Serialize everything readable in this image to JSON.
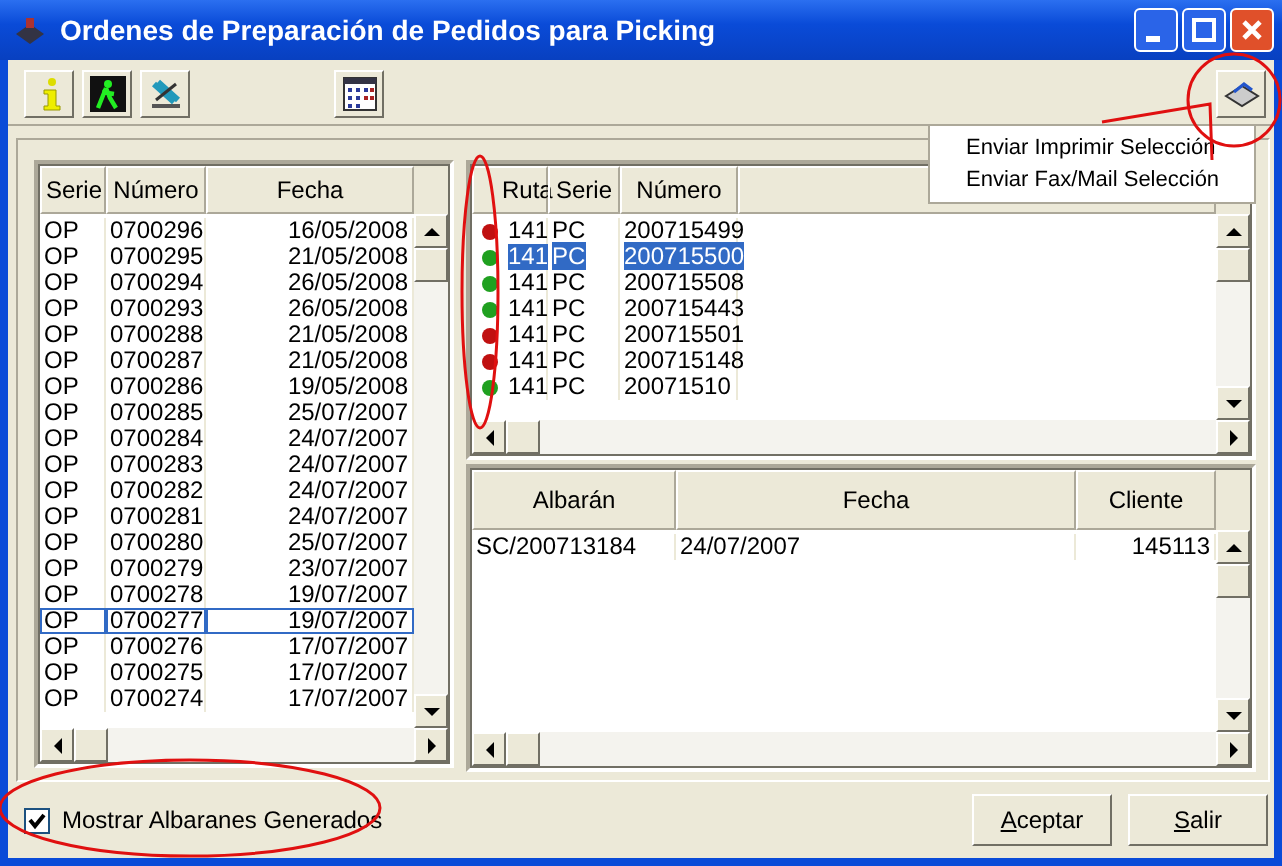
{
  "window": {
    "title": "Ordenes de Preparación de Pedidos para Picking"
  },
  "context_menu": {
    "items": [
      "Enviar Imprimir Selección",
      "Enviar Fax/Mail Selección"
    ]
  },
  "orders_table": {
    "columns": [
      "Serie",
      "Número",
      "Fecha"
    ],
    "rows": [
      {
        "serie": "OP",
        "numero": "0700296",
        "fecha": "16/05/2008",
        "selected": false
      },
      {
        "serie": "OP",
        "numero": "0700295",
        "fecha": "21/05/2008",
        "selected": false
      },
      {
        "serie": "OP",
        "numero": "0700294",
        "fecha": "26/05/2008",
        "selected": false
      },
      {
        "serie": "OP",
        "numero": "0700293",
        "fecha": "26/05/2008",
        "selected": false
      },
      {
        "serie": "OP",
        "numero": "0700288",
        "fecha": "21/05/2008",
        "selected": false
      },
      {
        "serie": "OP",
        "numero": "0700287",
        "fecha": "21/05/2008",
        "selected": false
      },
      {
        "serie": "OP",
        "numero": "0700286",
        "fecha": "19/05/2008",
        "selected": false
      },
      {
        "serie": "OP",
        "numero": "0700285",
        "fecha": "25/07/2007",
        "selected": false
      },
      {
        "serie": "OP",
        "numero": "0700284",
        "fecha": "24/07/2007",
        "selected": false
      },
      {
        "serie": "OP",
        "numero": "0700283",
        "fecha": "24/07/2007",
        "selected": false
      },
      {
        "serie": "OP",
        "numero": "0700282",
        "fecha": "24/07/2007",
        "selected": false
      },
      {
        "serie": "OP",
        "numero": "0700281",
        "fecha": "24/07/2007",
        "selected": false
      },
      {
        "serie": "OP",
        "numero": "0700280",
        "fecha": "25/07/2007",
        "selected": false
      },
      {
        "serie": "OP",
        "numero": "0700279",
        "fecha": "23/07/2007",
        "selected": false
      },
      {
        "serie": "OP",
        "numero": "0700278",
        "fecha": "19/07/2007",
        "selected": false
      },
      {
        "serie": "OP",
        "numero": "0700277",
        "fecha": "19/07/2007",
        "selected": true
      },
      {
        "serie": "OP",
        "numero": "0700276",
        "fecha": "17/07/2007",
        "selected": false
      },
      {
        "serie": "OP",
        "numero": "0700275",
        "fecha": "17/07/2007",
        "selected": false
      },
      {
        "serie": "OP",
        "numero": "0700274",
        "fecha": "17/07/2007",
        "selected": false
      }
    ]
  },
  "routes_table": {
    "columns": [
      "Ruta",
      "Serie",
      "Número"
    ],
    "rows": [
      {
        "color": "#c01010",
        "ruta": "141",
        "serie": "PC",
        "numero": "200715499",
        "selected": false
      },
      {
        "color": "#20a020",
        "ruta": "141",
        "serie": "PC",
        "numero": "200715500",
        "selected": true
      },
      {
        "color": "#20a020",
        "ruta": "141",
        "serie": "PC",
        "numero": "200715508",
        "selected": false
      },
      {
        "color": "#20a020",
        "ruta": "141",
        "serie": "PC",
        "numero": "200715443",
        "selected": false
      },
      {
        "color": "#c01010",
        "ruta": "141",
        "serie": "PC",
        "numero": "200715501",
        "selected": false
      },
      {
        "color": "#c01010",
        "ruta": "141",
        "serie": "PC",
        "numero": "200715148",
        "selected": false
      },
      {
        "color": "#20a020",
        "ruta": "141",
        "serie": "PC",
        "numero": "20071510",
        "selected": false
      }
    ]
  },
  "delivery_notes_table": {
    "columns": [
      "Albarán",
      "Fecha",
      "Cliente"
    ],
    "rows": [
      {
        "albaran": "SC/200713184",
        "fecha": "24/07/2007",
        "cliente": "145113"
      }
    ]
  },
  "show_generated_notes": {
    "label": "Mostrar Albaranes Generados",
    "checked": true
  },
  "buttons": [
    "Aceptar",
    "Salir"
  ]
}
